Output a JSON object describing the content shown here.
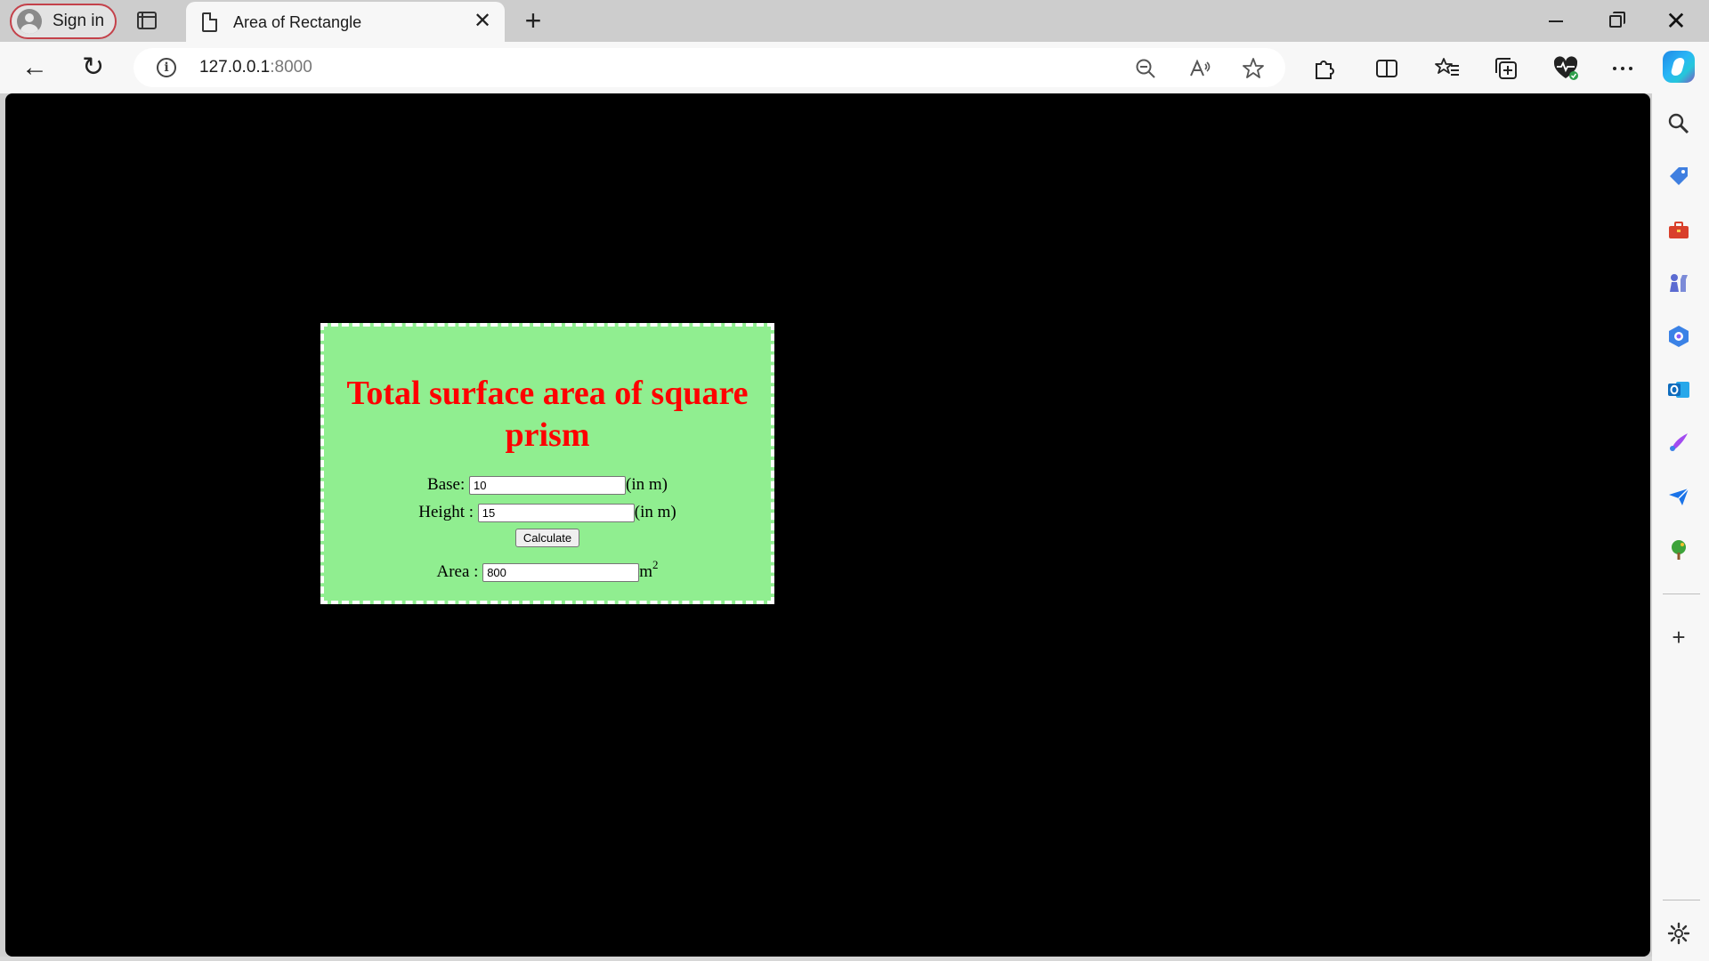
{
  "browser": {
    "signin_label": "Sign in",
    "tab_title": "Area of Rectangle",
    "tab_close_glyph": "✕",
    "new_tab_glyph": "+",
    "window_close_glyph": "✕",
    "url_host": "127.0.0.1",
    "url_port": ":8000",
    "back_glyph": "←",
    "reload_glyph": "↻"
  },
  "page": {
    "title": "Total surface area of square prism",
    "base": {
      "label": "Base:",
      "value": "10",
      "unit": "(in m)"
    },
    "height": {
      "label": "Height :",
      "value": "15",
      "unit": "(in m)"
    },
    "calculate_label": "Calculate",
    "area": {
      "label": "Area :",
      "value": "800",
      "unit": "m",
      "unit_sup": "2"
    }
  },
  "colors": {
    "box_bg": "#90ee90",
    "title_color": "#ff0000",
    "viewport_bg": "#000000"
  },
  "icons": [
    "search-icon",
    "tag-icon",
    "toolbox-icon",
    "chess-icon",
    "copilot-hex-icon",
    "outlook-icon",
    "designer-icon",
    "send-icon",
    "tree-icon",
    "add-icon",
    "settings-icon"
  ]
}
